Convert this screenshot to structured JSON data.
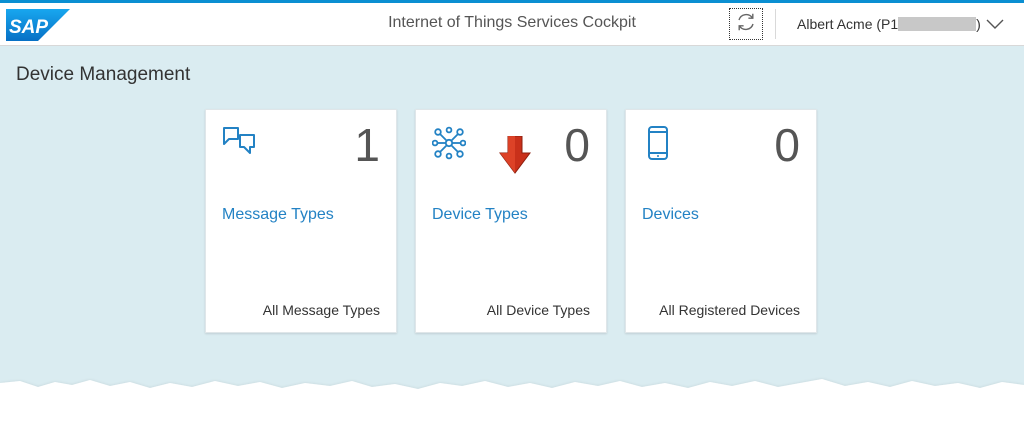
{
  "header": {
    "app_title": "Internet of Things Services Cockpit",
    "logo_text": "SAP",
    "user_name_prefix": "Albert Acme (P1",
    "user_name_suffix": ")"
  },
  "page": {
    "title": "Device Management"
  },
  "tiles": [
    {
      "icon": "message-bubbles-icon",
      "count": "1",
      "title": "Message Types",
      "footer": "All Message Types"
    },
    {
      "icon": "network-nodes-icon",
      "count": "0",
      "title": "Device Types",
      "footer": "All Device Types"
    },
    {
      "icon": "mobile-device-icon",
      "count": "0",
      "title": "Devices",
      "footer": "All Registered Devices"
    }
  ],
  "colors": {
    "accent": "#2382c4",
    "brand_blue": "#0a8fd2",
    "background": "#daecf1",
    "annotation_arrow": "#d9391d"
  }
}
